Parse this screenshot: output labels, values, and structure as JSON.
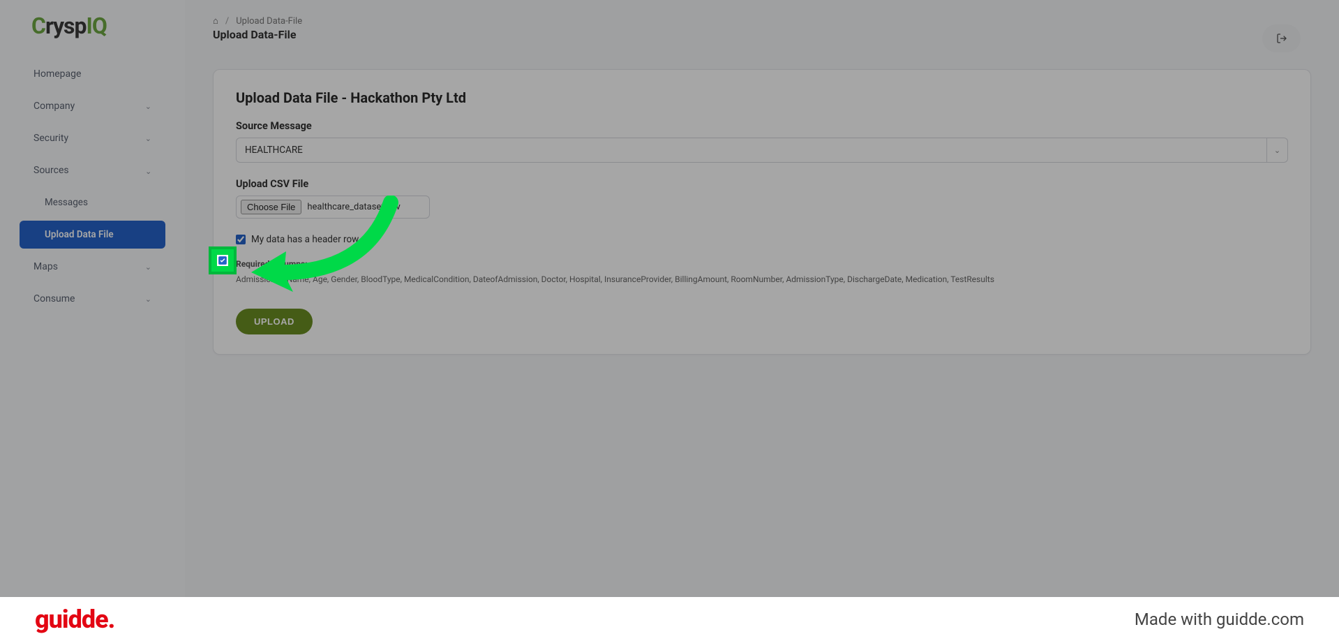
{
  "app": {
    "logo_parts": [
      "C",
      "rysp",
      "I",
      "Q"
    ]
  },
  "sidebar": {
    "items": [
      {
        "label": "Homepage",
        "expandable": false
      },
      {
        "label": "Company",
        "expandable": true,
        "expanded": false
      },
      {
        "label": "Security",
        "expandable": true,
        "expanded": false
      },
      {
        "label": "Sources",
        "expandable": true,
        "expanded": true
      },
      {
        "label": "Messages",
        "sub": true
      },
      {
        "label": "Upload Data File",
        "sub": true,
        "active": true
      },
      {
        "label": "Maps",
        "expandable": true,
        "expanded": false
      },
      {
        "label": "Consume",
        "expandable": true,
        "expanded": false
      }
    ]
  },
  "breadcrumb": {
    "trail": "Upload Data-File",
    "current": "Upload Data-File"
  },
  "card": {
    "title": "Upload Data File - Hackathon Pty Ltd",
    "source_label": "Source Message",
    "source_value": "HEALTHCARE",
    "upload_label": "Upload CSV File",
    "choose_btn": "Choose File",
    "file_name": "healthcare_dataset.csv",
    "checkbox_label": "My data has a header row",
    "checkbox_checked": true,
    "required_label": "Required Columns:",
    "required_cols": "AdmissionID, Name, Age, Gender, BloodType, MedicalCondition, DateofAdmission, Doctor, Hospital, InsuranceProvider, BillingAmount, RoomNumber, AdmissionType, DischargeDate, Medication, TestResults",
    "upload_btn": "UPLOAD"
  },
  "footer": {
    "logo": "guidde.",
    "text": "Made with guidde.com"
  },
  "colors": {
    "accent_green": "#00d948",
    "brand_blue": "#2563c9",
    "olive": "#6b8e23",
    "guidde_red": "#e30613"
  }
}
